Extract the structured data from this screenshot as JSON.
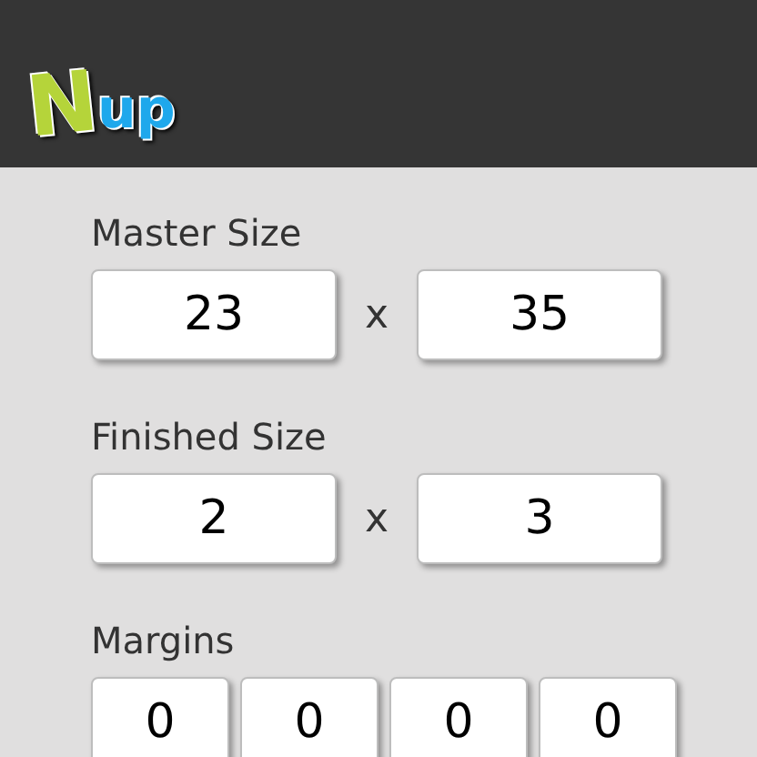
{
  "logo": {
    "initial": "N",
    "rest": "up"
  },
  "sections": [
    {
      "kind": "pair",
      "label": "Master Size",
      "values": [
        "23",
        "35"
      ],
      "separator": "x"
    },
    {
      "kind": "pair",
      "label": "Finished Size",
      "values": [
        "2",
        "3"
      ],
      "separator": "x"
    },
    {
      "kind": "quad",
      "label": "Margins",
      "values": [
        "0",
        "0",
        "0",
        "0"
      ]
    }
  ]
}
